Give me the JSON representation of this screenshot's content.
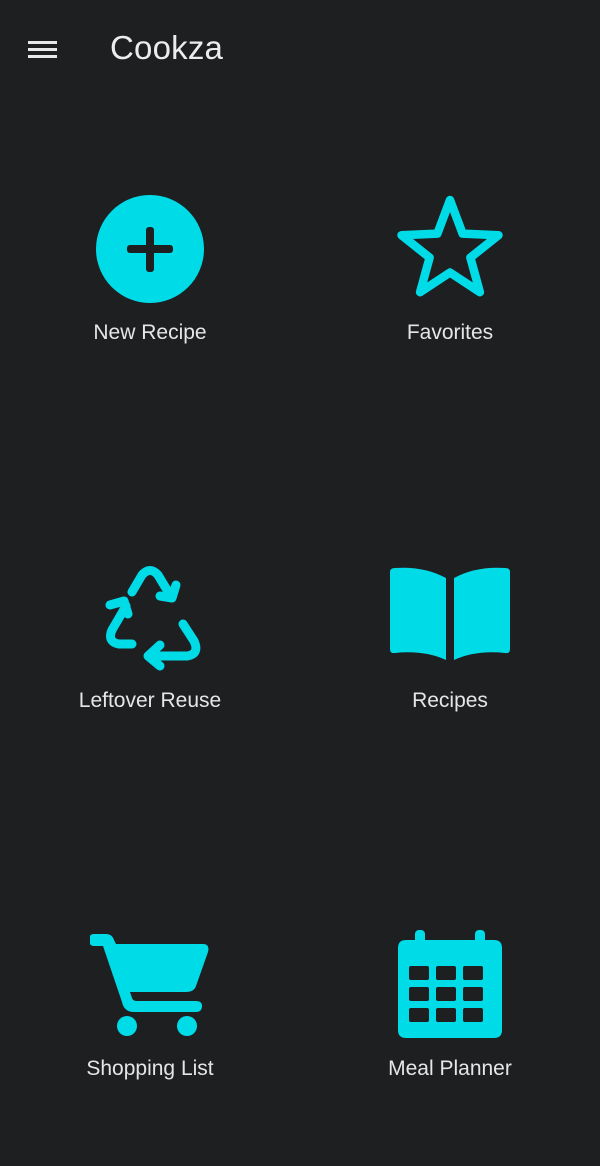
{
  "app": {
    "title": "Cookza",
    "menu_icon": "hamburger-menu-icon"
  },
  "colors": {
    "background": "#1e1f21",
    "accent": "#00dbe8",
    "text": "#e6e6e6"
  },
  "tiles": [
    {
      "label": "New Recipe",
      "icon": "add-circle-icon"
    },
    {
      "label": "Favorites",
      "icon": "star-outline-icon"
    },
    {
      "label": "Leftover Reuse",
      "icon": "recycle-icon"
    },
    {
      "label": "Recipes",
      "icon": "open-book-icon"
    },
    {
      "label": "Shopping List",
      "icon": "shopping-cart-icon"
    },
    {
      "label": "Meal Planner",
      "icon": "calendar-icon"
    }
  ]
}
